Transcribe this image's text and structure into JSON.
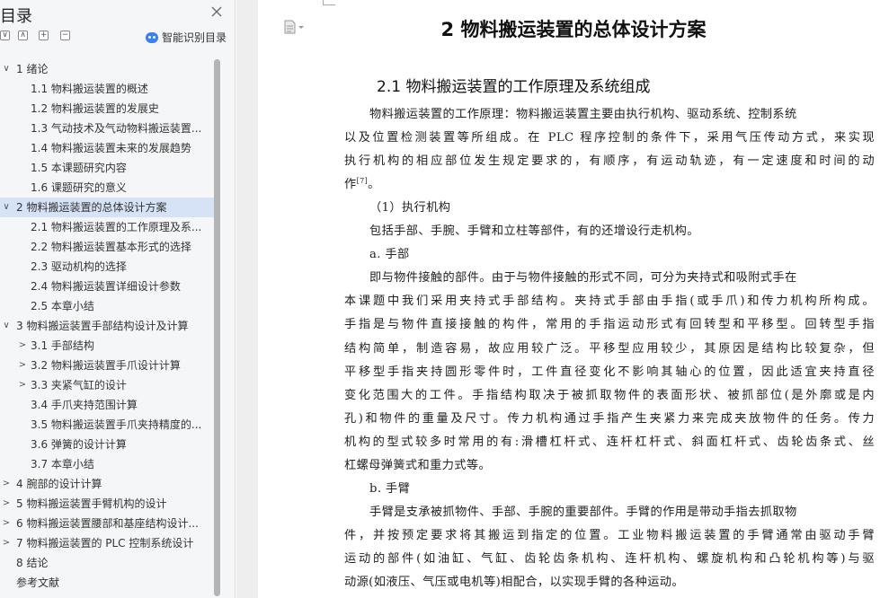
{
  "toc": {
    "title": "目录",
    "smart_label": "智能识别目录",
    "items": [
      {
        "arrow": "∨",
        "text": "1  绪论",
        "level": 1,
        "selected": false
      },
      {
        "arrow": "",
        "text": "1.1  物料搬运装置的概述",
        "level": 2,
        "selected": false
      },
      {
        "arrow": "",
        "text": "1.2  物料搬运装置的发展史",
        "level": 2,
        "selected": false
      },
      {
        "arrow": "",
        "text": "1.3  气动技术及气动物料搬运装置...",
        "level": 2,
        "selected": false
      },
      {
        "arrow": "",
        "text": "1.4  物料搬运装置未来的发展趋势",
        "level": 2,
        "selected": false
      },
      {
        "arrow": "",
        "text": "1.5  本课题研究内容",
        "level": 2,
        "selected": false
      },
      {
        "arrow": "",
        "text": "1.6  课题研究的意义",
        "level": 2,
        "selected": false
      },
      {
        "arrow": "∨",
        "text": "2  物料搬运装置的总体设计方案",
        "level": 1,
        "selected": true
      },
      {
        "arrow": "",
        "text": "2.1  物料搬运装置的工作原理及系...",
        "level": 2,
        "selected": false
      },
      {
        "arrow": "",
        "text": "2.2  物料搬运装置基本形式的选择",
        "level": 2,
        "selected": false
      },
      {
        "arrow": "",
        "text": "2.3  驱动机构的选择",
        "level": 2,
        "selected": false
      },
      {
        "arrow": "",
        "text": "2.4  物料搬运装置详细设计参数",
        "level": 2,
        "selected": false
      },
      {
        "arrow": "",
        "text": "2.5  本章小结",
        "level": 2,
        "selected": false
      },
      {
        "arrow": "∨",
        "text": "3  物料搬运装置手部结构设计及计算",
        "level": 1,
        "selected": false
      },
      {
        "arrow": ">",
        "text": "3.1  手部结构",
        "level": 2,
        "selected": false
      },
      {
        "arrow": ">",
        "text": "3.2  物料搬运装置手爪设计计算",
        "level": 2,
        "selected": false
      },
      {
        "arrow": ">",
        "text": "3.3  夹紧气缸的设计",
        "level": 2,
        "selected": false
      },
      {
        "arrow": "",
        "text": "3.4  手爪夹持范围计算",
        "level": 2,
        "selected": false
      },
      {
        "arrow": "",
        "text": "3.5  物料搬运装置手爪夹持精度的...",
        "level": 2,
        "selected": false
      },
      {
        "arrow": "",
        "text": "3.6  弹簧的设计计算",
        "level": 2,
        "selected": false
      },
      {
        "arrow": "",
        "text": "3.7  本章小结",
        "level": 2,
        "selected": false
      },
      {
        "arrow": ">",
        "text": "4  腕部的设计计算",
        "level": 1,
        "selected": false
      },
      {
        "arrow": ">",
        "text": "5  物料搬运装置手臂机构的设计",
        "level": 1,
        "selected": false
      },
      {
        "arrow": ">",
        "text": "6  物料搬运装置腰部和基座结构设计...",
        "level": 1,
        "selected": false
      },
      {
        "arrow": ">",
        "text": "7  物料搬运装置的 PLC 控制系统设计",
        "level": 1,
        "selected": false
      },
      {
        "arrow": "",
        "text": "8  结论",
        "level": 1,
        "selected": false
      },
      {
        "arrow": "",
        "text": "参考文献",
        "level": 1,
        "selected": false
      }
    ]
  },
  "document": {
    "title": "2  物料搬运装置的总体设计方案",
    "section": "2.1  物料搬运装置的工作原理及系统组成",
    "lines": [
      {
        "text": "物料搬运装置的工作原理：物料搬运装置主要由执行机构、驱动系统、控制系统",
        "style": "indent"
      },
      {
        "text": "以及位置检测装置等所组成。在 PLC 程序控制的条件下，采用气压传动方式，来实现",
        "style": "justify"
      },
      {
        "text": "执行机构的相应部位发生规定要求的，有顺序，有运动轨迹，有一定速度和时间的动",
        "style": "justify"
      },
      {
        "text": "作",
        "style": "plain",
        "sup": "[7]",
        "tail": "。"
      },
      {
        "text": "（1）执行机构",
        "style": "indent"
      },
      {
        "text": "包括手部、手腕、手臂和立柱等部件，有的还增设行走机构。",
        "style": "indent"
      },
      {
        "text": "a. 手部",
        "style": "sub"
      },
      {
        "text": "即与物件接触的部件。由于与物件接触的形式不同，可分为夹持式和吸附式手在",
        "style": "indent"
      },
      {
        "text": "本课题中我们采用夹持式手部结构。夹持式手部由手指(或手爪)和传力机构所构成。",
        "style": "justify"
      },
      {
        "text": "手指是与物件直接接触的构件，常用的手指运动形式有回转型和平移型。回转型手指",
        "style": "justify"
      },
      {
        "text": "结构简单，制造容易，故应用较广泛。平移型应用较少，其原因是结构比较复杂，但",
        "style": "justify"
      },
      {
        "text": "平移型手指夹持圆形零件时，工件直径变化不影响其轴心的位置，因此适宜夹持直径",
        "style": "justify"
      },
      {
        "text": "变化范围大的工件。手指结构取决于被抓取物件的表面形状、被抓部位(是外廓或是内",
        "style": "justify"
      },
      {
        "text": "孔)和物件的重量及尺寸。传力机构通过手指产生夹紧力来完成夹放物件的任务。传力",
        "style": "justify"
      },
      {
        "text": "机构的型式较多时常用的有:滑槽杠杆式、连杆杠杆式、斜面杠杆式、齿轮齿条式、丝",
        "style": "justify"
      },
      {
        "text": "杠螺母弹簧式和重力式等。",
        "style": "plain"
      },
      {
        "text": "b. 手臂",
        "style": "sub"
      },
      {
        "text": "手臂是支承被抓物件、手部、手腕的重要部件。手臂的作用是带动手指去抓取物",
        "style": "indent"
      },
      {
        "text": "件，并按预定要求将其搬运到指定的位置。工业物料搬运装置的手臂通常由驱动手臂",
        "style": "justify"
      },
      {
        "text": "运动的部件(如油缸、气缸、齿轮齿条机构、连杆机构、螺旋机构和凸轮机构等)与驱",
        "style": "justify"
      },
      {
        "text": "动源(如液压、气压或电机等)相配合，以实现手臂的各种运动。",
        "style": "plain"
      }
    ]
  }
}
